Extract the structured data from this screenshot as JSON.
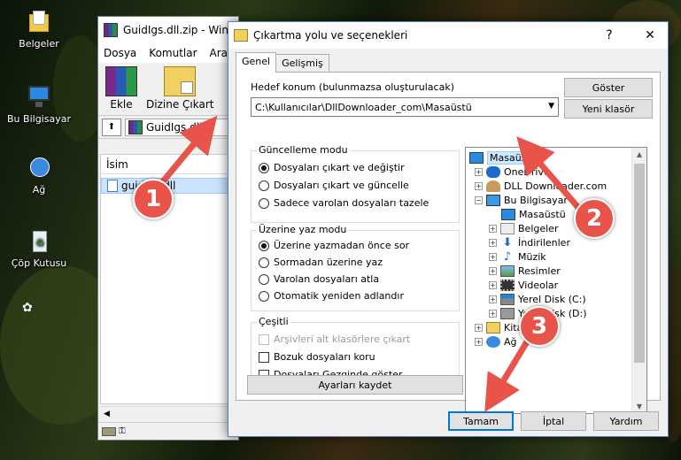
{
  "desktop": {
    "icons": [
      {
        "name": "desktop-icon-documents",
        "label": "Belgeler"
      },
      {
        "name": "desktop-icon-this-pc",
        "label": "Bu Bilgisayar"
      },
      {
        "name": "desktop-icon-network",
        "label": "Ağ"
      },
      {
        "name": "desktop-icon-recycle-bin",
        "label": "Çöp Kutusu"
      }
    ]
  },
  "winrar": {
    "title": "GuidIgs.dll.zip - Win",
    "menu": [
      "Dosya",
      "Komutlar",
      "Araçla"
    ],
    "toolbar": {
      "add_label": "Ekle",
      "extract_label": "Dizine Çıkart"
    },
    "path_text": "GuidIgs.dll.",
    "column_name": "İsim",
    "file_name": "guidigs.dll"
  },
  "dialog": {
    "title": "Çıkartma yolu ve seçenekleri",
    "close_glyph": "✕",
    "help_glyph": "?",
    "tabs": [
      "Genel",
      "Gelişmiş"
    ],
    "destination_label": "Hedef konum (bulunmazsa oluşturulacak)",
    "destination_value": "C:\\Kullanıcılar\\DllDownloader_com\\Masaüstü",
    "show_button": "Göster",
    "new_folder_button": "Yeni klasör",
    "update_mode": {
      "title": "Güncelleme modu",
      "options": [
        "Dosyaları çıkart ve değiştir",
        "Dosyaları çıkart ve güncelle",
        "Sadece varolan dosyaları tazele"
      ],
      "selected": 0
    },
    "overwrite_mode": {
      "title": "Üzerine yaz modu",
      "options": [
        "Üzerine yazmadan önce sor",
        "Sormadan üzerine yaz",
        "Varolan dosyaları atla",
        "Otomatik yeniden adlandır"
      ],
      "selected": 0
    },
    "misc": {
      "title": "Çeşitli",
      "options": [
        {
          "label": "Arşivleri alt klasörlere çıkart",
          "disabled": true
        },
        {
          "label": "Bozuk dosyaları koru",
          "disabled": false
        },
        {
          "label": "Dosyaları Gezginde göster",
          "disabled": false
        }
      ]
    },
    "save_settings_button": "Ayarları kaydet",
    "tree": [
      {
        "label": "Masaüstü",
        "selected": true,
        "toggle": "",
        "icon": "desktop-icon"
      },
      {
        "label": "OneDrive",
        "toggle": "+",
        "icon": "onedrive-icon"
      },
      {
        "label": "DLL Downloader.com",
        "toggle": "+",
        "icon": "user-icon"
      },
      {
        "label": "Bu Bilgisayar",
        "toggle": "−",
        "icon": "computer-icon"
      },
      {
        "label": "Masaüstü",
        "toggle": "",
        "icon": "desktop-icon"
      },
      {
        "label": "Belgeler",
        "toggle": "+",
        "icon": "documents-icon"
      },
      {
        "label": "İndirilenler",
        "toggle": "+",
        "icon": "download-icon"
      },
      {
        "label": "Müzik",
        "toggle": "+",
        "icon": "music-icon"
      },
      {
        "label": "Resimler",
        "toggle": "+",
        "icon": "pictures-icon"
      },
      {
        "label": "Videolar",
        "toggle": "+",
        "icon": "videos-icon"
      },
      {
        "label": "Yerel Disk (C:)",
        "toggle": "+",
        "icon": "drive-icon"
      },
      {
        "label": "Yerel Disk (D:)",
        "toggle": "+",
        "icon": "drive-icon"
      },
      {
        "label": "Kitaplıklar",
        "toggle": "+",
        "icon": "library-icon"
      },
      {
        "label": "Ağ",
        "toggle": "+",
        "icon": "network-icon"
      }
    ],
    "ok_button": "Tamam",
    "cancel_button": "İptal",
    "help_button": "Yardım"
  },
  "callouts": [
    "1",
    "2",
    "3"
  ],
  "colors": {
    "callout": "#e8534a",
    "selection": "#cce8ff",
    "accent": "#0078d7"
  }
}
